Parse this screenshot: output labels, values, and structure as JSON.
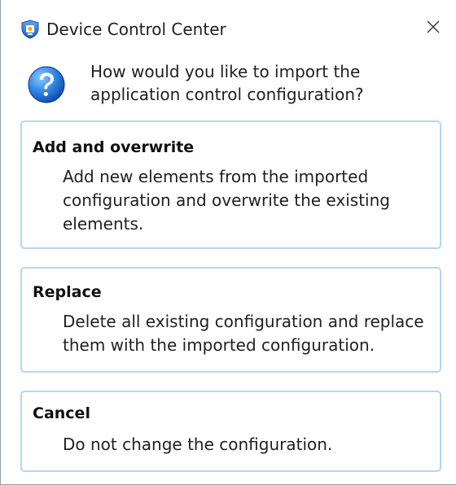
{
  "window": {
    "title": "Device Control Center",
    "close_icon": "close-icon",
    "app_icon": "device-control-app-icon"
  },
  "prompt": {
    "icon": "question-icon",
    "text": "How would you like to import the application control configuration?"
  },
  "options": [
    {
      "title": "Add and overwrite",
      "description": "Add new elements from the imported configuration and overwrite the existing elements."
    },
    {
      "title": "Replace",
      "description": "Delete all existing configuration and replace them with the imported configuration."
    },
    {
      "title": "Cancel",
      "description": "Do not change the configuration."
    }
  ],
  "colors": {
    "option_border": "#b5d5f7",
    "question_blue": "#1f6fd1",
    "text": "#1f1f1f"
  }
}
